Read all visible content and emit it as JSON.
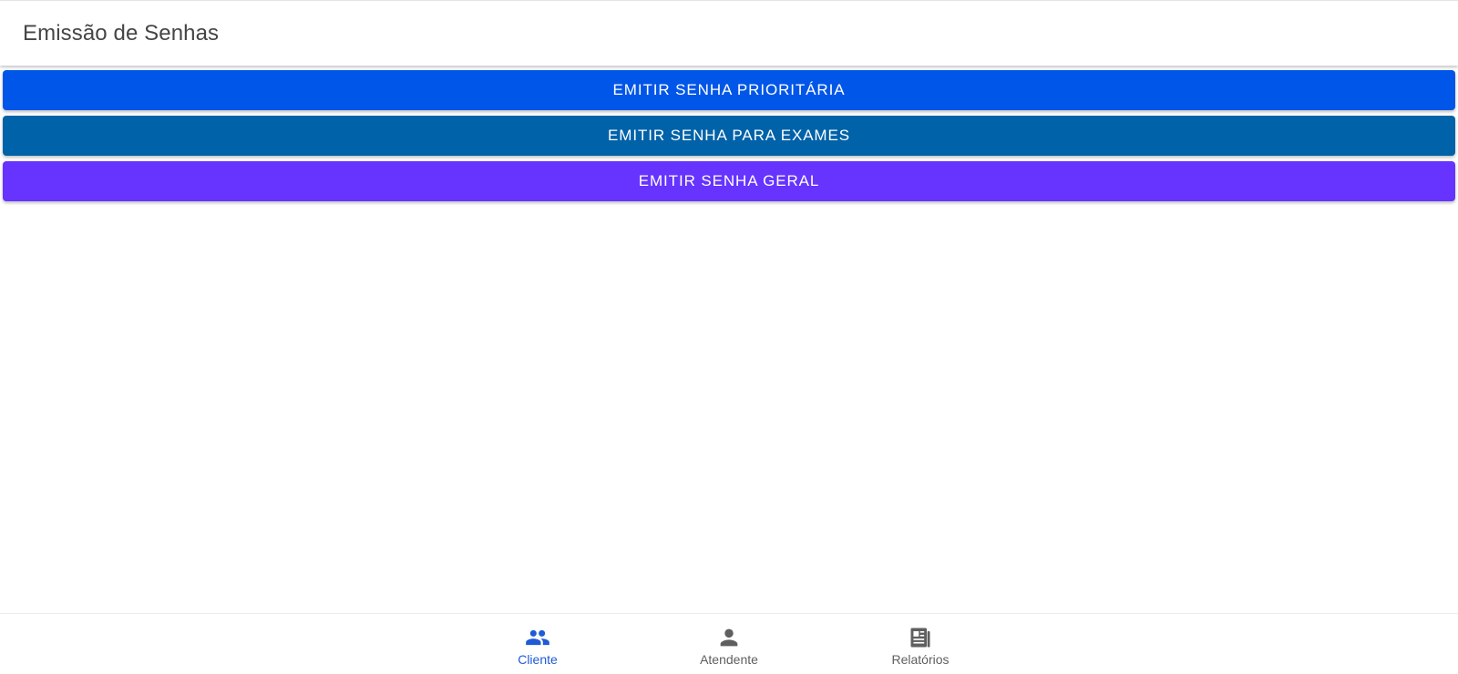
{
  "header": {
    "title": "Emissão de Senhas"
  },
  "buttons": [
    {
      "label": "EMITIR SENHA PRIORITÁRIA",
      "color": "#0056e8"
    },
    {
      "label": "EMITIR SENHA PARA EXAMES",
      "color": "#0062a8"
    },
    {
      "label": "EMITIR SENHA GERAL",
      "color": "#6633ff"
    }
  ],
  "bottom_nav": {
    "active_color": "#1f5bd6",
    "inactive_color": "#5f5f5f",
    "items": [
      {
        "label": "Cliente",
        "icon": "people-icon",
        "active": true
      },
      {
        "label": "Atendente",
        "icon": "person-icon",
        "active": false
      },
      {
        "label": "Relatórios",
        "icon": "newspaper-icon",
        "active": false
      }
    ]
  }
}
